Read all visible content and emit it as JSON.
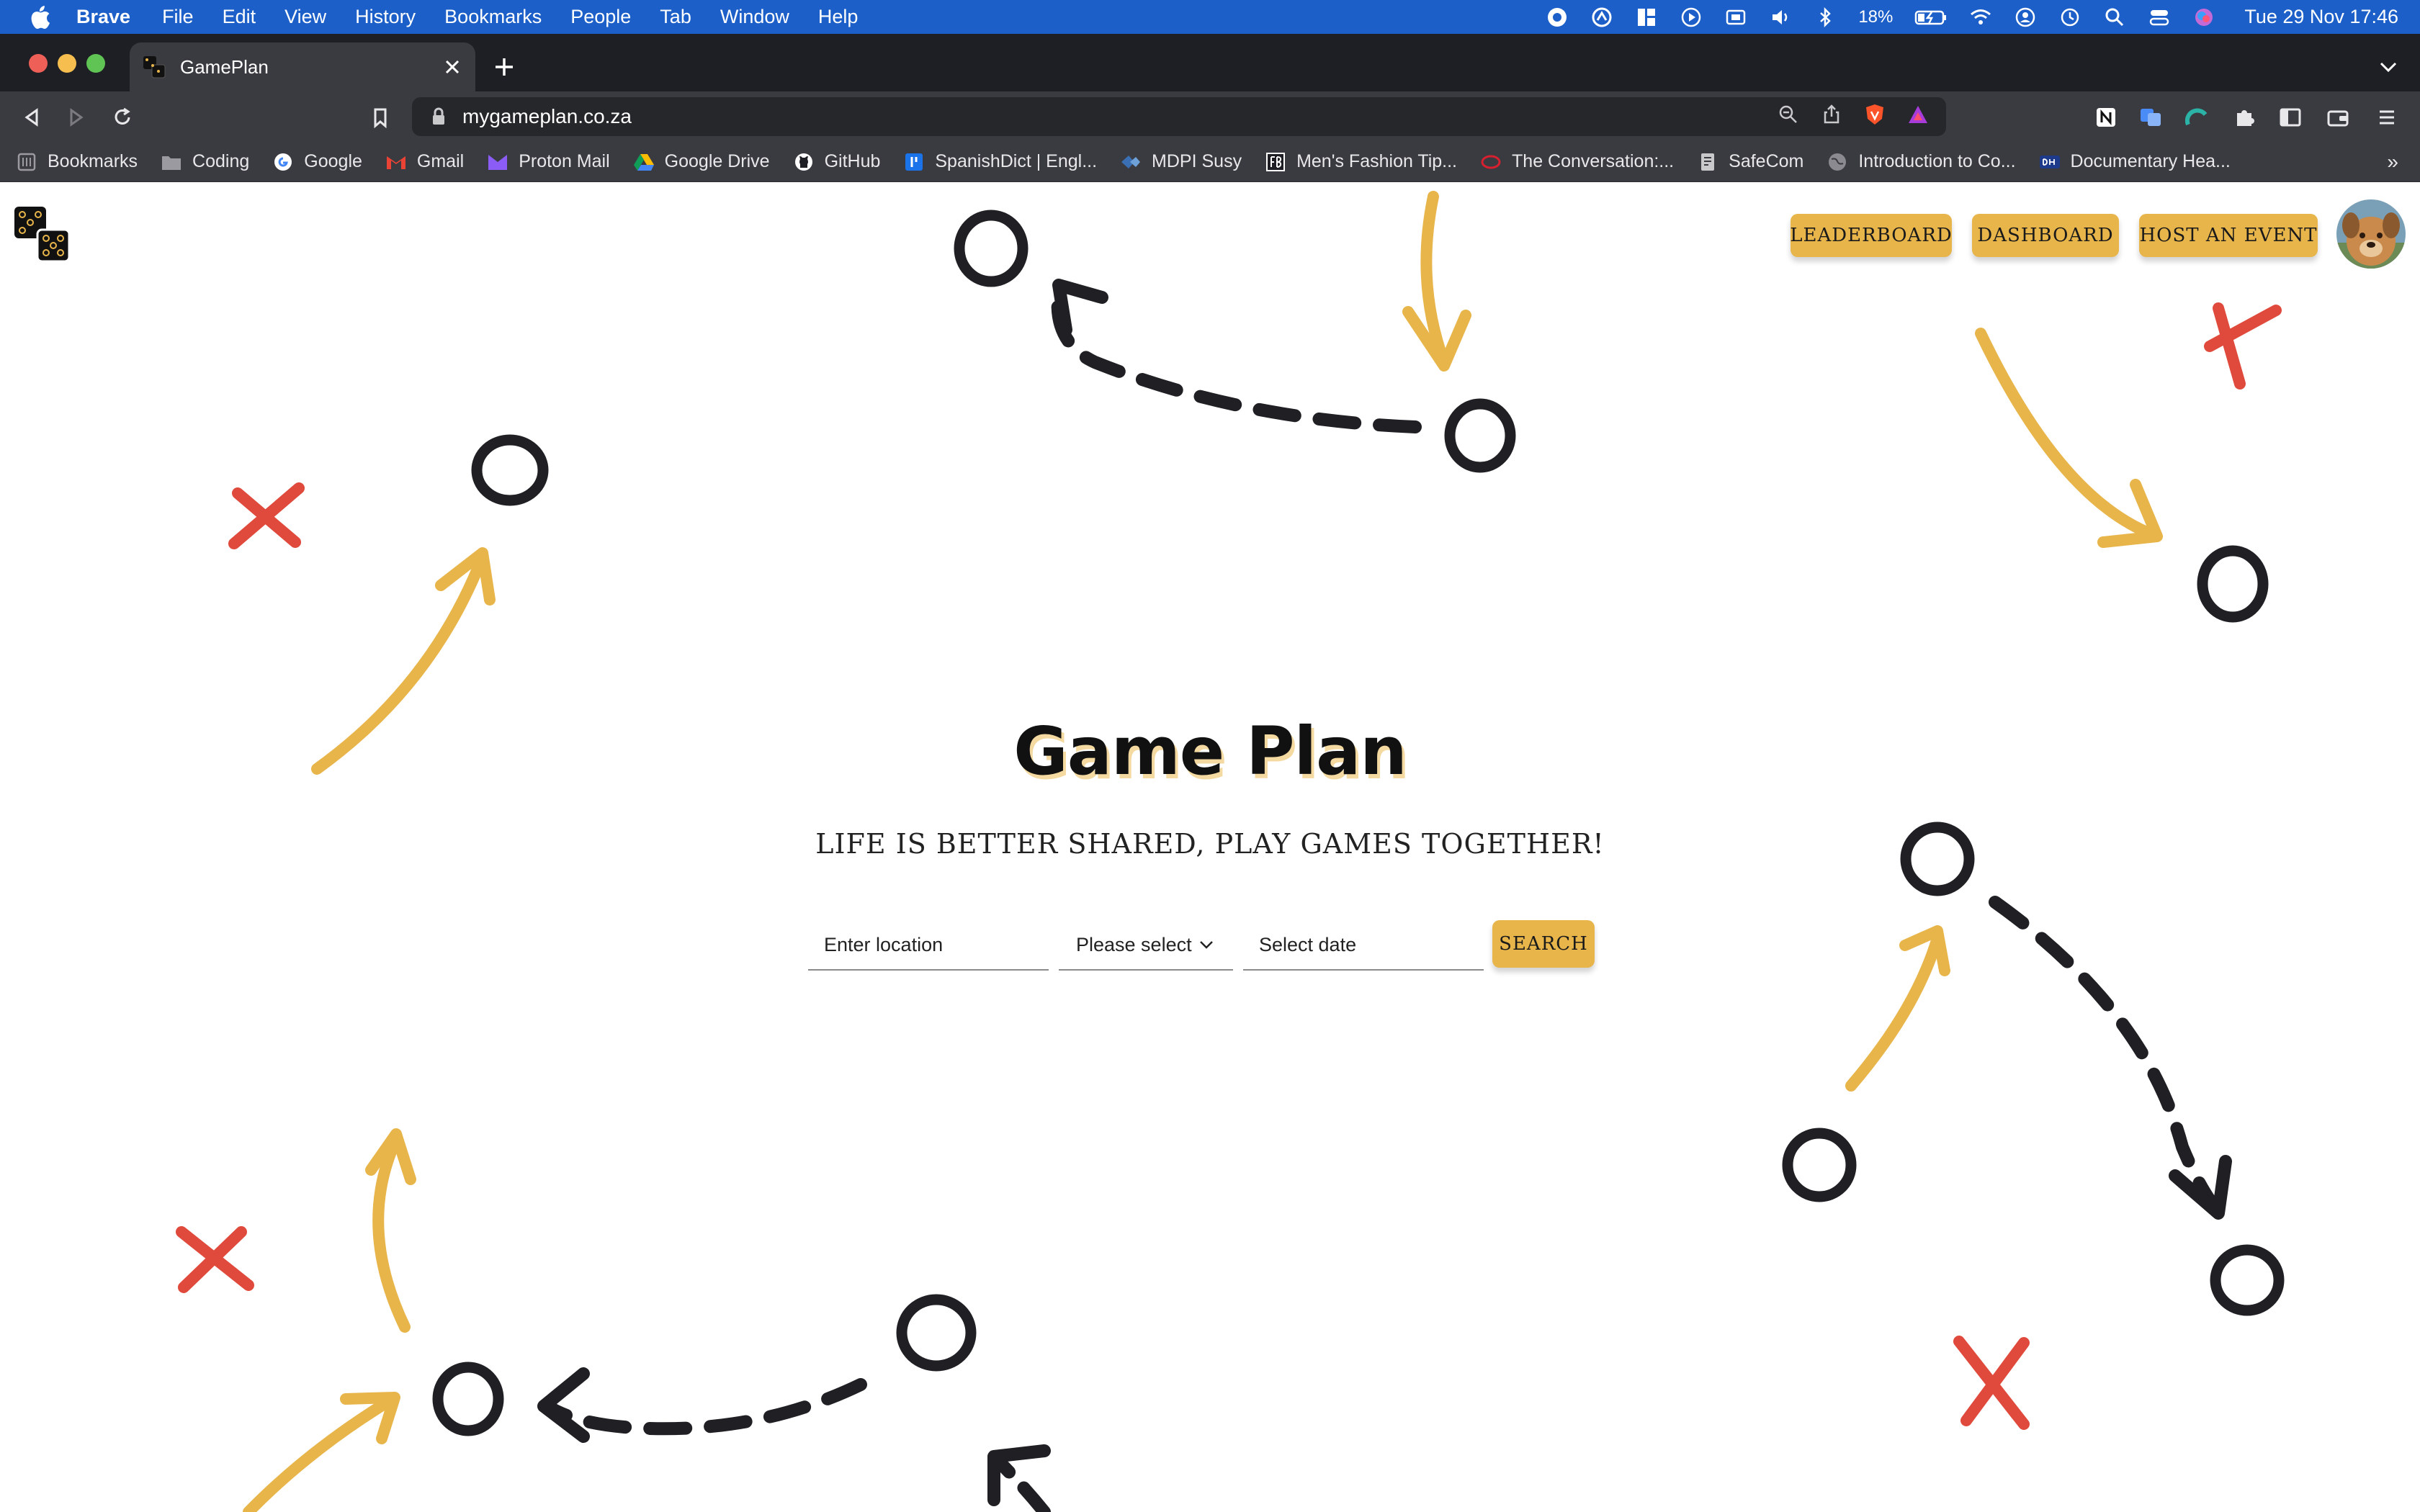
{
  "menubar": {
    "app": "Brave",
    "items": [
      "File",
      "Edit",
      "View",
      "History",
      "Bookmarks",
      "People",
      "Tab",
      "Window",
      "Help"
    ],
    "battery": "18%",
    "clock": "Tue 29 Nov  17:46"
  },
  "browser": {
    "tab_title": "GamePlan",
    "url": "mygameplan.co.za",
    "bookmarks": [
      {
        "label": "Bookmarks",
        "icon": "bookmarks-icon"
      },
      {
        "label": "Coding",
        "icon": "folder-icon"
      },
      {
        "label": "Google",
        "icon": "google-icon"
      },
      {
        "label": "Gmail",
        "icon": "gmail-icon"
      },
      {
        "label": "Proton Mail",
        "icon": "proton-icon"
      },
      {
        "label": "Google Drive",
        "icon": "drive-icon"
      },
      {
        "label": "GitHub",
        "icon": "github-icon"
      },
      {
        "label": "SpanishDict | Engl...",
        "icon": "spanishdict-icon"
      },
      {
        "label": "MDPI Susy",
        "icon": "mdpi-icon"
      },
      {
        "label": "Men's Fashion Tip...",
        "icon": "fashion-icon"
      },
      {
        "label": "The Conversation:...",
        "icon": "conversation-icon"
      },
      {
        "label": "SafeCom",
        "icon": "safecom-icon"
      },
      {
        "label": "Introduction to Co...",
        "icon": "globe-icon"
      },
      {
        "label": "Documentary Hea...",
        "icon": "documentary-icon"
      }
    ],
    "more": "»"
  },
  "nav": {
    "leaderboard": "LEADERBOARD",
    "dashboard": "DASHBOARD",
    "host": "HOST AN EVENT"
  },
  "hero": {
    "title": "Game Plan",
    "subtitle": "LIFE IS BETTER SHARED, PLAY GAMES TOGETHER!"
  },
  "search": {
    "location_placeholder": "Enter location",
    "game_select": "Please select",
    "date_placeholder": "Select date",
    "button": "SEARCH"
  },
  "colors": {
    "accent": "#e8b54b",
    "mark_x": "#e04a3c",
    "mark_o": "#1f1f24",
    "arrow_gold": "#e8b54b"
  }
}
